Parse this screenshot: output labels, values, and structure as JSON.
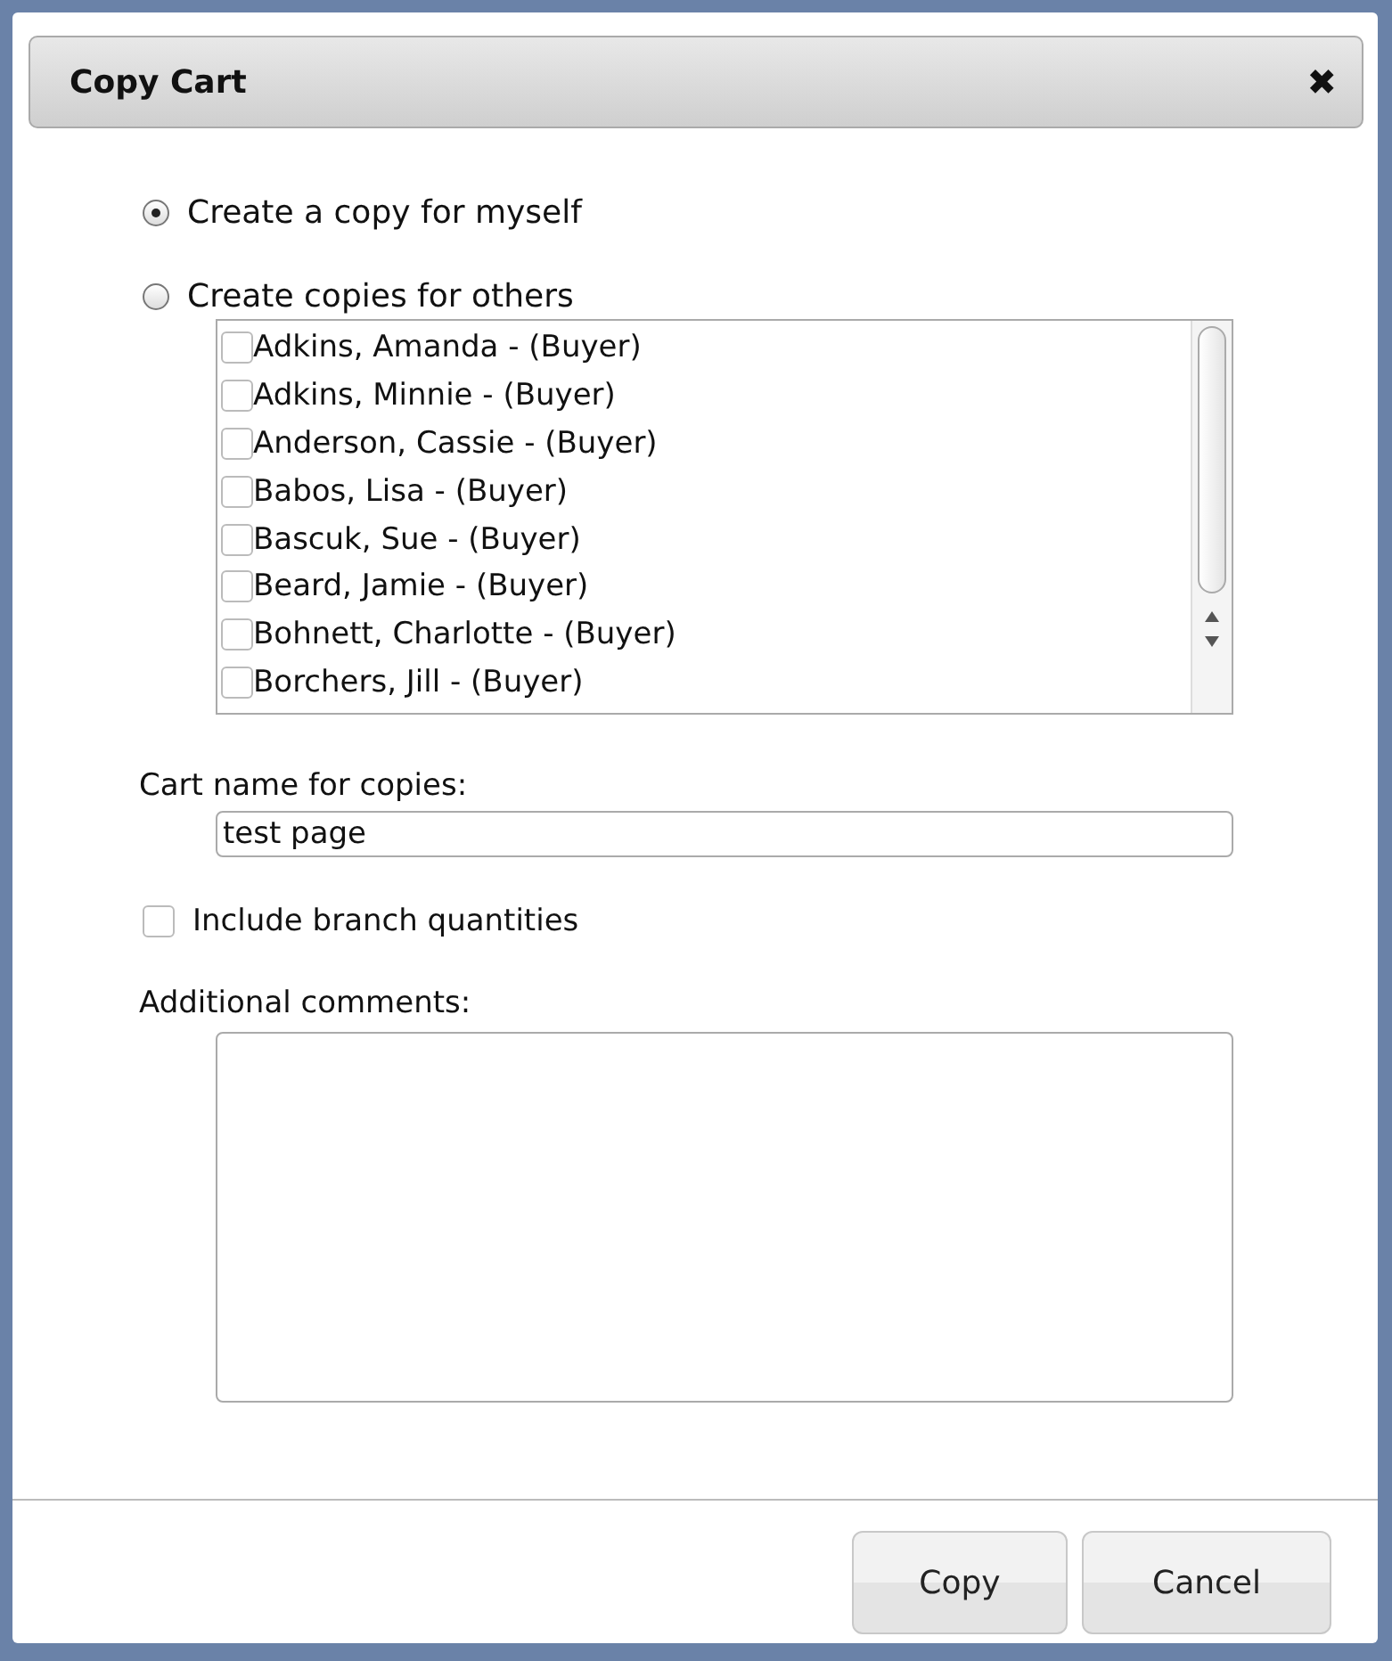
{
  "dialog": {
    "title": "Copy Cart",
    "close": "✖"
  },
  "options": [
    {
      "label": "Create a copy for myself",
      "selected": true
    },
    {
      "label": "Create copies for others",
      "selected": false
    }
  ],
  "recipients": [
    {
      "label": "Adkins, Amanda - (Buyer)",
      "checked": false
    },
    {
      "label": "Adkins, Minnie - (Buyer)",
      "checked": false
    },
    {
      "label": "Anderson, Cassie - (Buyer)",
      "checked": false
    },
    {
      "label": "Babos, Lisa - (Buyer)",
      "checked": false
    },
    {
      "label": "Bascuk, Sue - (Buyer)",
      "checked": false
    },
    {
      "label": "Beard, Jamie - (Buyer)",
      "checked": false
    },
    {
      "label": "Bohnett, Charlotte - (Buyer)",
      "checked": false
    },
    {
      "label": "Borchers, Jill - (Buyer)",
      "checked": false
    }
  ],
  "cart_name": {
    "label": "Cart name for copies:",
    "value": "test page"
  },
  "include_branch": {
    "label": "Include branch quantities",
    "checked": false
  },
  "comments": {
    "label": "Additional comments:"
  },
  "buttons": [
    "Copy",
    "Cancel"
  ]
}
